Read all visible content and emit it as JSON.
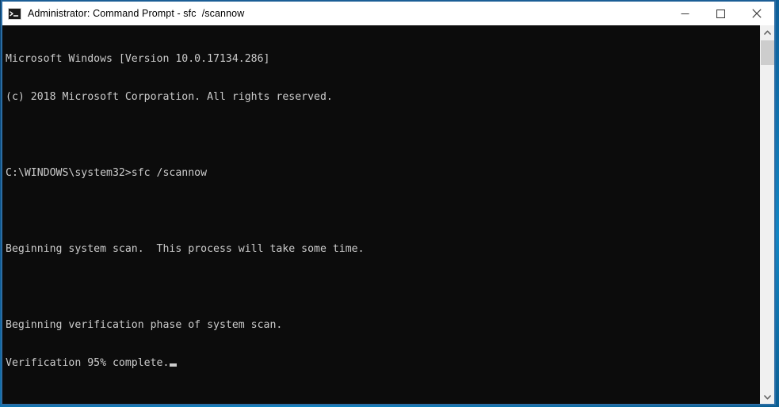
{
  "window": {
    "title": "Administrator: Command Prompt - sfc  /scannow",
    "icon": "command-prompt-icon",
    "border_color": "#2c6da4",
    "titlebar_background": "#ffffff",
    "controls": {
      "minimize_label": "Minimize",
      "maximize_label": "Maximize",
      "close_label": "Close"
    }
  },
  "console": {
    "background": "#0c0c0c",
    "foreground": "#cccccc",
    "lines": [
      "Microsoft Windows [Version 10.0.17134.286]",
      "(c) 2018 Microsoft Corporation. All rights reserved.",
      "",
      "C:\\WINDOWS\\system32>sfc /scannow",
      "",
      "Beginning system scan.  This process will take some time.",
      "",
      "Beginning verification phase of system scan.",
      "Verification 95% complete."
    ],
    "prompt_path": "C:\\WINDOWS\\system32>",
    "command": "sfc /scannow",
    "os_version": "10.0.17134.286",
    "copyright_year": "2018",
    "progress_percent": "95%",
    "cursor_visible": true
  },
  "scrollbar": {
    "up_arrow": "chevron-up-icon",
    "down_arrow": "chevron-down-icon",
    "track_color": "#f0f0f0",
    "thumb_color": "#cdcdcd"
  }
}
